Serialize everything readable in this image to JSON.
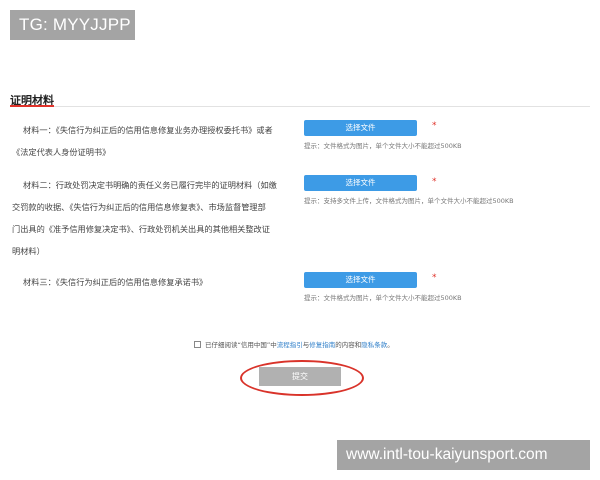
{
  "watermark_top": "TG: MYYJJPP",
  "watermark_bottom": "www.intl-tou-kaiyunsport.com",
  "section": {
    "title": "证明材料"
  },
  "materials": [
    {
      "line1": "材料一：《失信行为纠正后的信用信息修复业务办理授权委托书》或者",
      "line2": "《法定代表人身份证明书》",
      "button": "选择文件",
      "required": "*",
      "hint": "提示：文件格式为图片，单个文件大小不能超过500KB"
    },
    {
      "line1": "材料二：行政处罚决定书明确的责任义务已履行完毕的证明材料（如缴",
      "line2": "交罚款的收据、《失信行为纠正后的信用信息修复表》、市场监督管理部",
      "line3": "门出具的《准予信用修复决定书》、行政处罚机关出具的其他相关整改证",
      "line4": "明材料）",
      "button": "选择文件",
      "required": "*",
      "hint": "提示：支持多文件上传，文件格式为图片，单个文件大小不能超过500KB"
    },
    {
      "line1": "材料三：《失信行为纠正后的信用信息修复承诺书》",
      "button": "选择文件",
      "required": "*",
      "hint": "提示：文件格式为图片，单个文件大小不能超过500KB"
    }
  ],
  "agreement": {
    "prefix": "已仔细阅读“信用中国”中",
    "link1": "流程指引",
    "and": "与",
    "link2": "修复指南",
    "middle": "的内容和",
    "link3": "隐私条款",
    "suffix": "。"
  },
  "submit_label": "提交"
}
